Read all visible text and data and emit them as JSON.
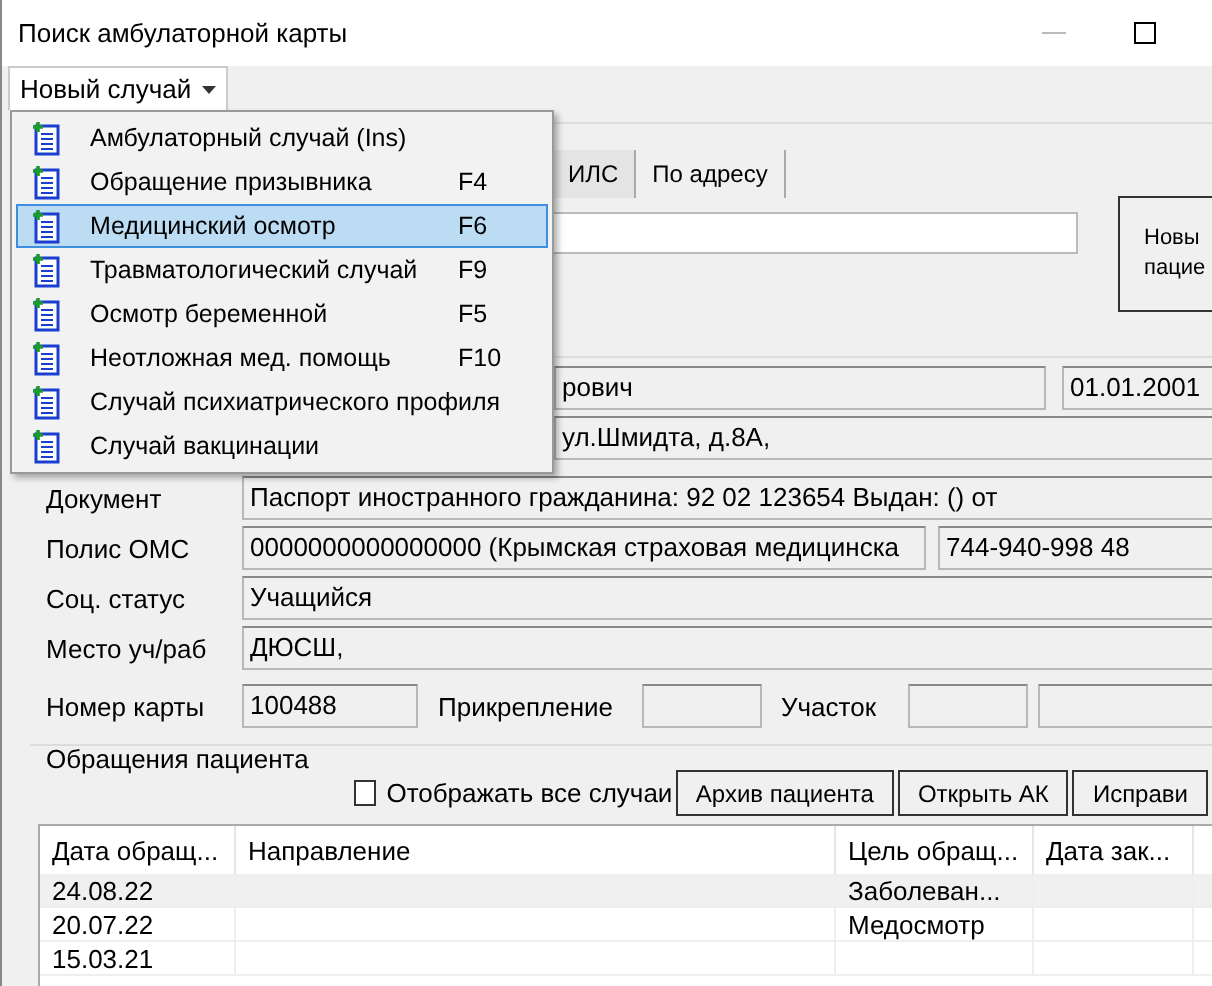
{
  "window": {
    "title": "Поиск амбулаторной карты"
  },
  "menu_button": {
    "label": "Новый случай",
    "expanded": true
  },
  "menu_items": [
    {
      "label": "Амбулаторный случай (Ins)",
      "selected": false
    },
    {
      "label": "Обращение призывника",
      "shortcut": "F4",
      "selected": false
    },
    {
      "label": "Медицинский осмотр",
      "shortcut": "F6",
      "selected": true
    },
    {
      "label": "Травматологический случай",
      "shortcut": "F9",
      "selected": false
    },
    {
      "label": "Осмотр беременной",
      "shortcut": "F5",
      "selected": false
    },
    {
      "label": "Неотложная мед. помощь",
      "shortcut": "F10",
      "selected": false
    },
    {
      "label": "Случай психиатрического профиля",
      "selected": false
    },
    {
      "label": "Случай вакцинации",
      "selected": false
    }
  ],
  "search": {
    "tabs": [
      {
        "label": "ИЛС",
        "selected": true
      },
      {
        "label": "По адресу",
        "selected": false
      }
    ],
    "new_patient_button": [
      "Новы",
      "пацие"
    ]
  },
  "patient": {
    "name": "рович",
    "birth_date": "01.01.2001",
    "address": "ул.Шмидта, д.8А,"
  },
  "fields": [
    {
      "label": "Документ",
      "values": [
        "Паспорт иностранного гражданина: 92 02 123654 Выдан: () от"
      ]
    },
    {
      "label": "Полис ОМС",
      "values": [
        "0000000000000000 (Крымская страховая медицинска",
        "744-940-998 48"
      ]
    },
    {
      "label": "Соц. статус",
      "values": [
        "Учащийся"
      ]
    },
    {
      "label": "Место уч/раб",
      "values": [
        "ДЮСШ,"
      ]
    }
  ],
  "card": {
    "number_label": "Номер карты",
    "number": "100488",
    "attachment_label": "Прикрепление",
    "district_label": "Участок"
  },
  "visits": {
    "title": "Обращения пациента",
    "show_all": {
      "label": "Отображать все случаи",
      "checked": false
    },
    "buttons": [
      "Архив пациента",
      "Открыть АК",
      "Исправи"
    ],
    "columns": [
      "Дата обращ...",
      "Направление",
      "Цель обращ...",
      "Дата зак..."
    ],
    "rows": [
      {
        "date": "24.08.22",
        "purpose": "Заболеван...",
        "selected": true
      },
      {
        "date": "20.07.22",
        "purpose": "Медосмотр",
        "selected": false
      },
      {
        "date": "15.03.21",
        "selected": false
      }
    ]
  }
}
